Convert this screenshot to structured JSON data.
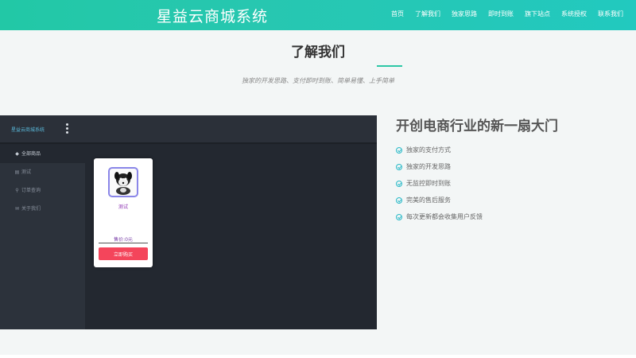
{
  "header": {
    "brand": "星益云商城系统",
    "nav": [
      "首页",
      "了解我们",
      "独家思路",
      "即时到账",
      "旗下站点",
      "系统授权",
      "联系我们"
    ]
  },
  "about": {
    "title": "了解我们",
    "subtitle": "独家的开发思路、支付即时到账、简单易懂、上手简单"
  },
  "preview": {
    "brand": "星益云商城系统",
    "sidebar": [
      {
        "icon": "cube-icon",
        "label": "全部商品"
      },
      {
        "icon": "table-icon",
        "label": "测试"
      },
      {
        "icon": "search-icon",
        "label": "订单查询"
      },
      {
        "icon": "envelope-icon",
        "label": "关于我们"
      }
    ],
    "product": {
      "name": "测试",
      "price": "售价:0元",
      "buy_label": "立即购买"
    }
  },
  "features": {
    "title": "开创电商行业的新一扇大门",
    "items": [
      "独家的支付方式",
      "独家的开发思路",
      "无监控即时到账",
      "完美的售后服务",
      "每次更新都会收集用户反馈"
    ]
  },
  "colors": {
    "accent": "#2cc7a6",
    "buy_button": "#f4455b",
    "preview_bg": "#232830"
  }
}
